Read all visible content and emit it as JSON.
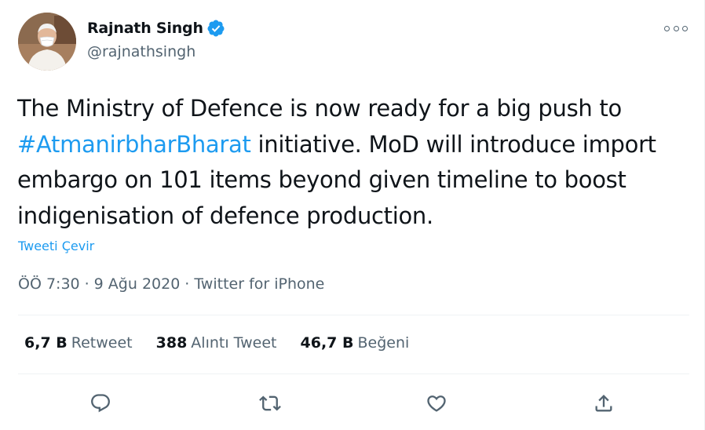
{
  "colors": {
    "accent": "#1d9bf0",
    "text": "#0f1419",
    "secondary": "#536471",
    "divider": "#eff3f4"
  },
  "author": {
    "name": "Rajnath Singh",
    "handle": "@rajnathsingh",
    "verified_icon": "verified-badge-icon",
    "avatar_icon": "profile-photo"
  },
  "more_icon": "more-options-icon",
  "tweet": {
    "text_1": "The Ministry of Defence is now ready for a big push to ",
    "hashtag": "#AtmanirbharBharat",
    "text_2": " initiative. MoD will introduce import embargo on 101 items beyond given timeline to boost indigenisation of defence production.",
    "translate_label": "Tweeti Çevir"
  },
  "meta": {
    "time": "ÖÖ 7:30",
    "separator": "·",
    "date": "9 Ağu 2020",
    "source": "Twitter for iPhone"
  },
  "stats": {
    "retweets_count": "6,7 B",
    "retweets_label": "Retweet",
    "quotes_count": "388",
    "quotes_label": "Alıntı Tweet",
    "likes_count": "46,7 B",
    "likes_label": "Beğeni"
  },
  "actions": [
    {
      "icon": "reply-icon"
    },
    {
      "icon": "retweet-icon"
    },
    {
      "icon": "like-icon"
    },
    {
      "icon": "share-icon"
    }
  ]
}
